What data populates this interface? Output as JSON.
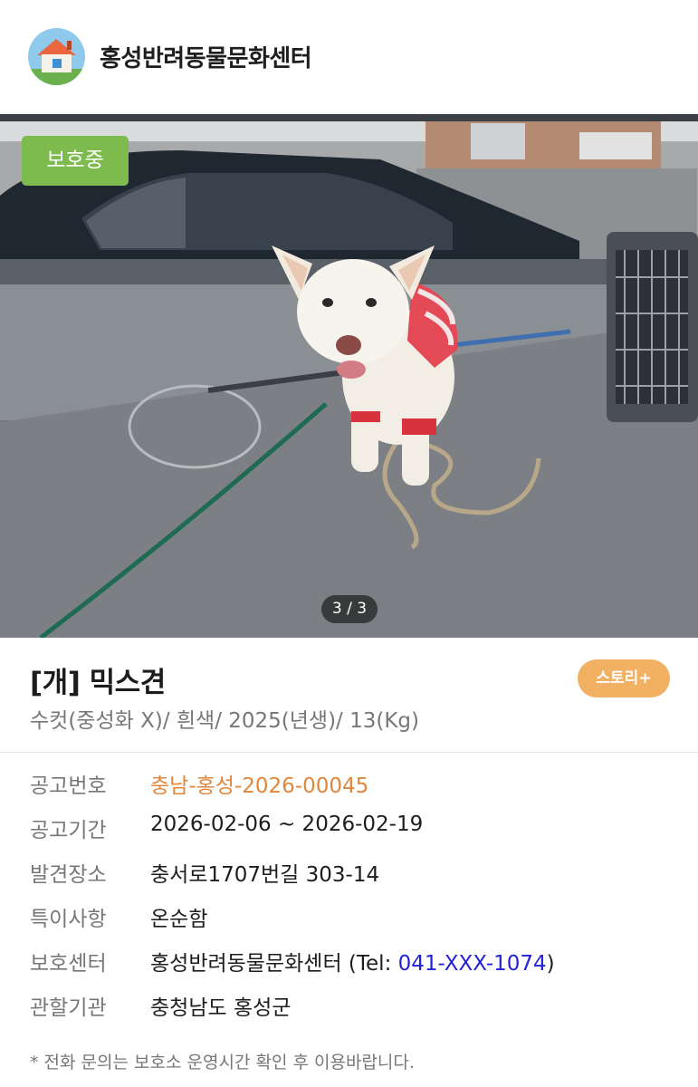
{
  "header": {
    "center_name": "홍성반려동물문화센터",
    "logo_icon": "house-logo-icon"
  },
  "photo": {
    "status_badge": "보호중",
    "page_indicator": "3 / 3"
  },
  "animal": {
    "title": "[개] 믹스견",
    "summary": "수컷(중성화 X)/ 흰색/ 2025(년생)/ 13(Kg)",
    "story_button": "스토리+"
  },
  "details": {
    "notice_no_label": "공고번호",
    "notice_no_value": "충남-홍성-2026-00045",
    "period_label": "공고기간",
    "period_value": "2026-02-06 ~ 2026-02-19",
    "location_label": "발견장소",
    "location_value": "충서로1707번길 303-14",
    "feature_label": "특이사항",
    "feature_value": "온순함",
    "shelter_label": "보호센터",
    "shelter_name": "홍성반려동물문화센터 (Tel: ",
    "shelter_tel": "041-XXX-1074",
    "shelter_close": ")",
    "agency_label": "관할기관",
    "agency_value": "충청남도 홍성군"
  },
  "footnote": "* 전화 문의는 보호소 운영시간 확인 후 이용바랍니다.",
  "colors": {
    "status_green": "#7dbb4e",
    "story_orange": "#f2b063",
    "notice_orange": "#e0873d",
    "tel_blue": "#2323d6"
  }
}
